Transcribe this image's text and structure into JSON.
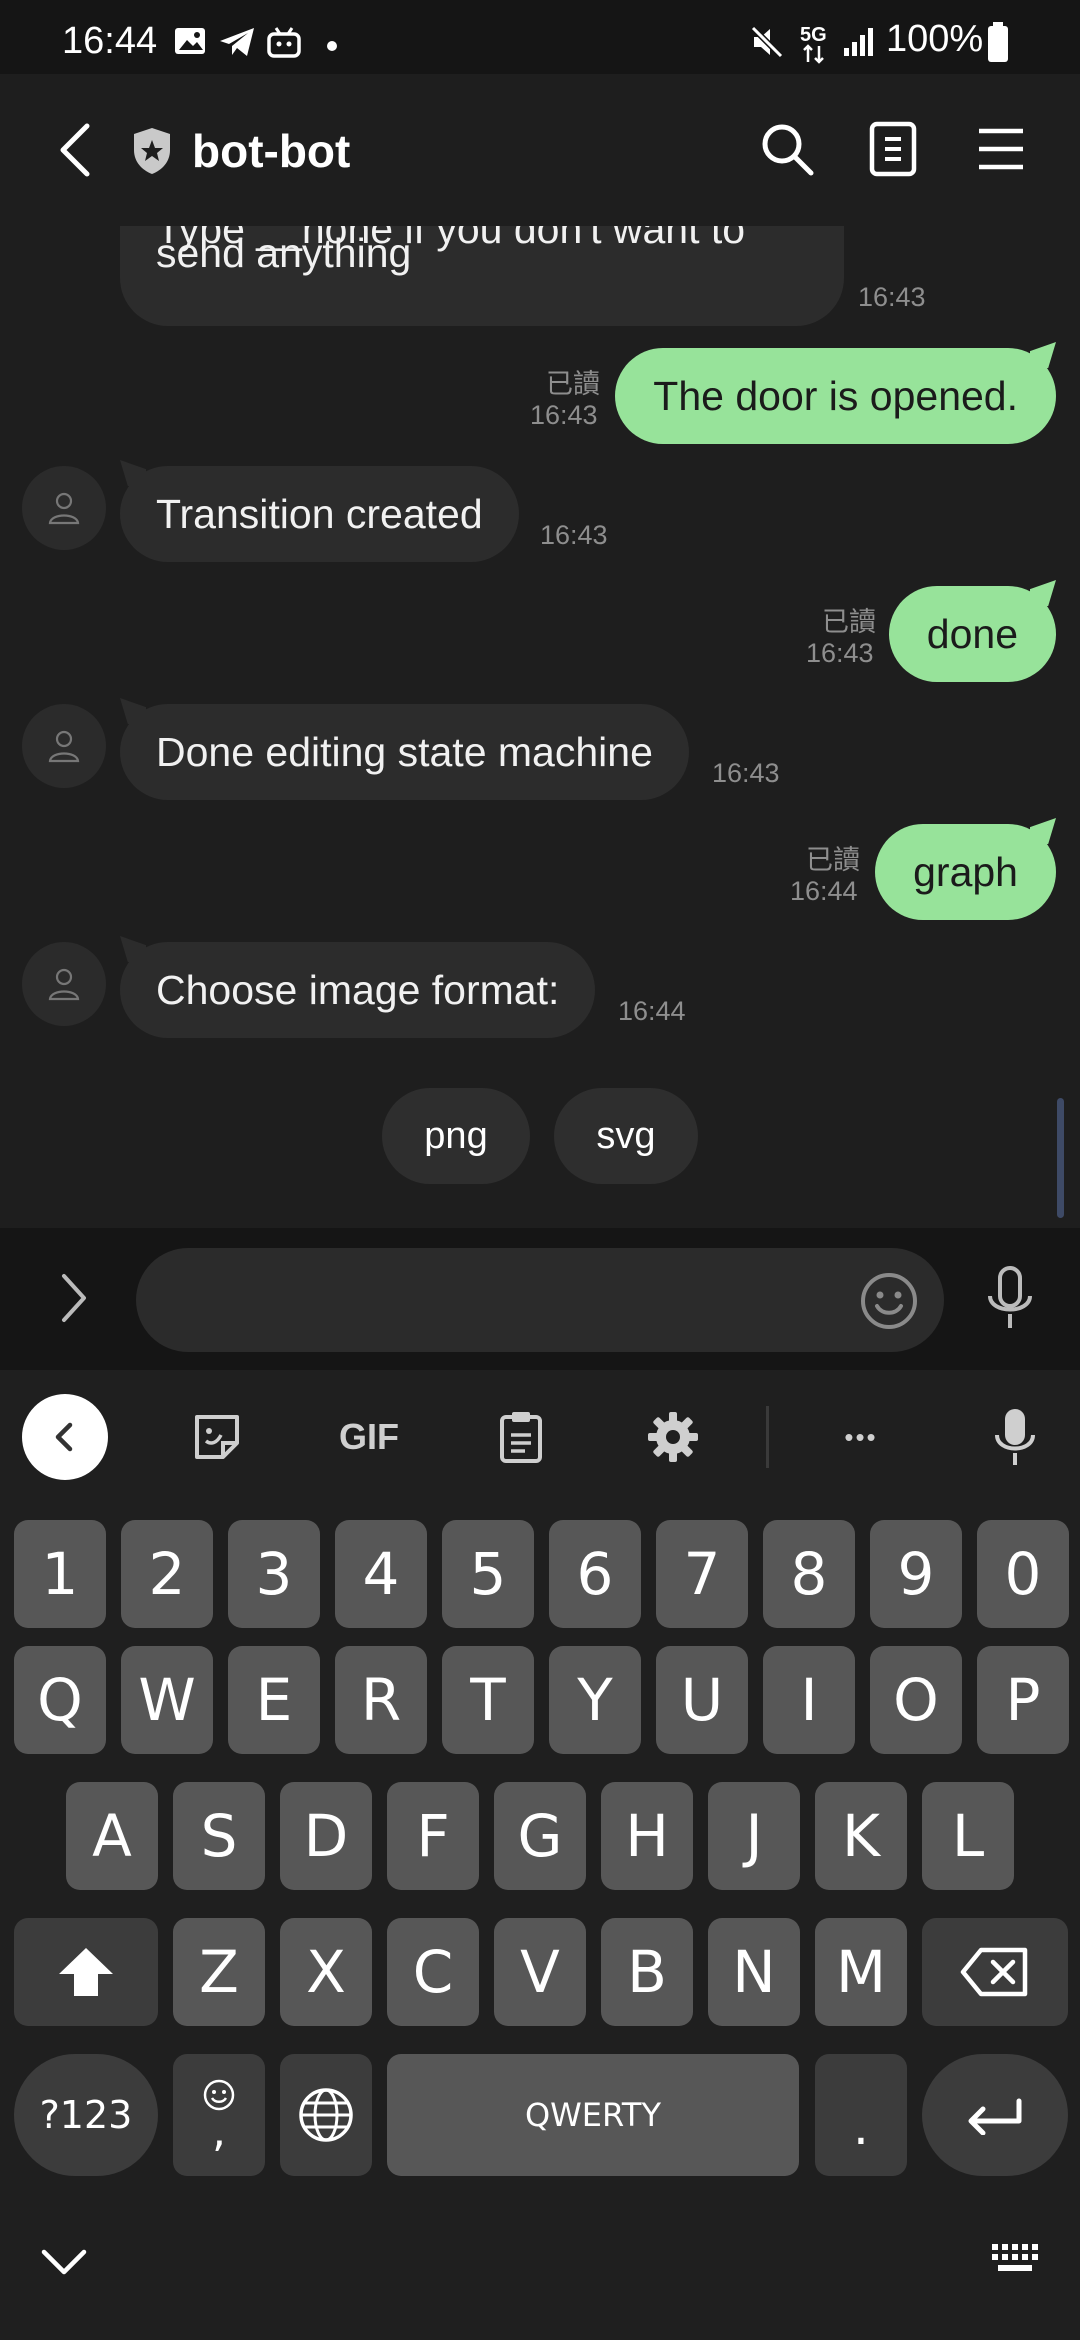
{
  "status_bar": {
    "time": "16:44",
    "network": "5G",
    "battery": "100%",
    "icons": [
      "image-icon",
      "telegram-icon",
      "bot-icon",
      "dot-icon",
      "mute-icon",
      "signal-icon",
      "battery-icon"
    ]
  },
  "header": {
    "title": "bot-bot",
    "icons": [
      "back-icon",
      "shield-icon",
      "search-icon",
      "notes-icon",
      "menu-icon"
    ]
  },
  "messages": [
    {
      "dir": "in",
      "text_line1": "Type __none if you don't want to",
      "text_line2": "send anything",
      "time": "16:43"
    },
    {
      "dir": "out",
      "text": "The door is opened.",
      "read": "已讀",
      "time": "16:43"
    },
    {
      "dir": "in",
      "text": "Transition created",
      "time": "16:43"
    },
    {
      "dir": "out",
      "text": "done",
      "read": "已讀",
      "time": "16:43"
    },
    {
      "dir": "in",
      "text": "Done editing state machine",
      "time": "16:43"
    },
    {
      "dir": "out",
      "text": "graph",
      "read": "已讀",
      "time": "16:44"
    },
    {
      "dir": "in",
      "text": "Choose image format:",
      "time": "16:44"
    }
  ],
  "quick_replies": [
    "png",
    "svg"
  ],
  "input": {
    "placeholder": "",
    "value": ""
  },
  "keyboard": {
    "toolbar": [
      "collapse-icon",
      "sticker-icon",
      "GIF",
      "clipboard-icon",
      "settings-icon",
      "more-icon",
      "mic-icon"
    ],
    "gif_label": "GIF",
    "more_label": "•••",
    "row_numbers": [
      "1",
      "2",
      "3",
      "4",
      "5",
      "6",
      "7",
      "8",
      "9",
      "0"
    ],
    "row1": [
      "Q",
      "W",
      "E",
      "R",
      "T",
      "Y",
      "U",
      "I",
      "O",
      "P"
    ],
    "row2": [
      "A",
      "S",
      "D",
      "F",
      "G",
      "H",
      "J",
      "K",
      "L"
    ],
    "row3": [
      "Z",
      "X",
      "C",
      "V",
      "B",
      "N",
      "M"
    ],
    "symbols_label": "?123",
    "comma_label": ",",
    "space_label": "QWERTY",
    "period_label": "."
  }
}
